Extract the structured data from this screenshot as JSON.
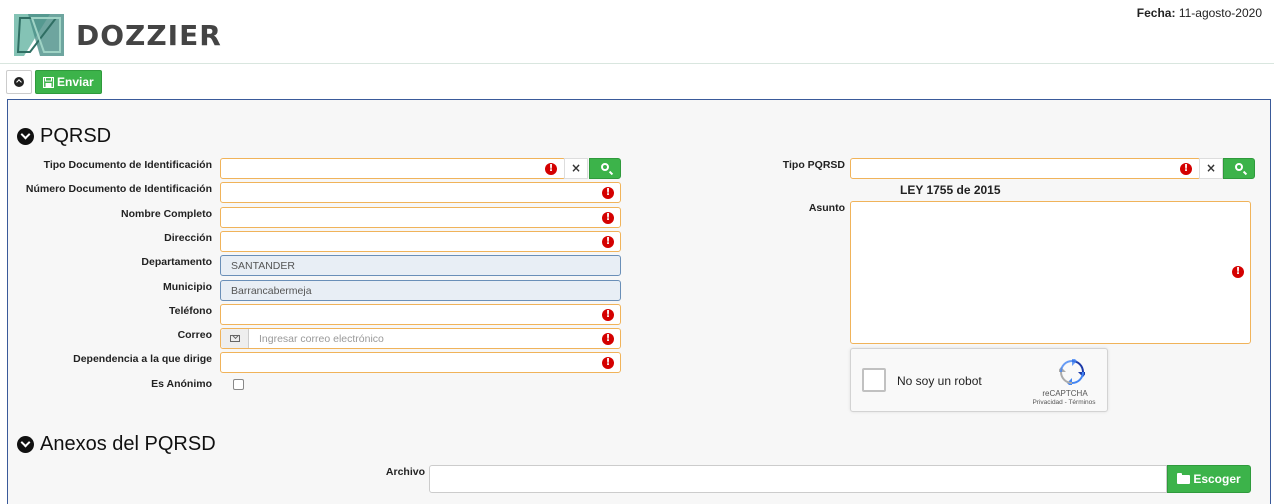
{
  "header": {
    "brand": "DOZZIER",
    "fecha_label": "Fecha:",
    "fecha_value": "11-agosto-2020"
  },
  "toolbar": {
    "enviar_label": "Enviar"
  },
  "pqrsd": {
    "title": "PQRSD",
    "fields": {
      "tipo_documento_label": "Tipo Documento de Identificación",
      "numero_documento_label": "Número Documento de Identificación",
      "nombre_label": "Nombre Completo",
      "direccion_label": "Dirección",
      "departamento_label": "Departamento",
      "departamento_value": "SANTANDER",
      "municipio_label": "Municipio",
      "municipio_value": "Barrancabermeja",
      "telefono_label": "Teléfono",
      "correo_label": "Correo",
      "correo_placeholder": "Ingresar correo electrónico",
      "dependencia_label": "Dependencia a la que dirige",
      "anonimo_label": "Es Anónimo",
      "tipo_pqrsd_label": "Tipo PQRSD",
      "ley_text": "LEY 1755 de 2015",
      "asunto_label": "Asunto"
    },
    "captcha": {
      "label": "No soy un robot",
      "brand": "reCAPTCHA",
      "links": "Privacidad - Términos"
    }
  },
  "anexos": {
    "title": "Anexos del PQRSD",
    "archivo_label": "Archivo",
    "escoger_label": "Escoger"
  },
  "colors": {
    "accent_green": "#3cb34a",
    "required_border": "#f0b35a",
    "error_red": "#d40000"
  }
}
